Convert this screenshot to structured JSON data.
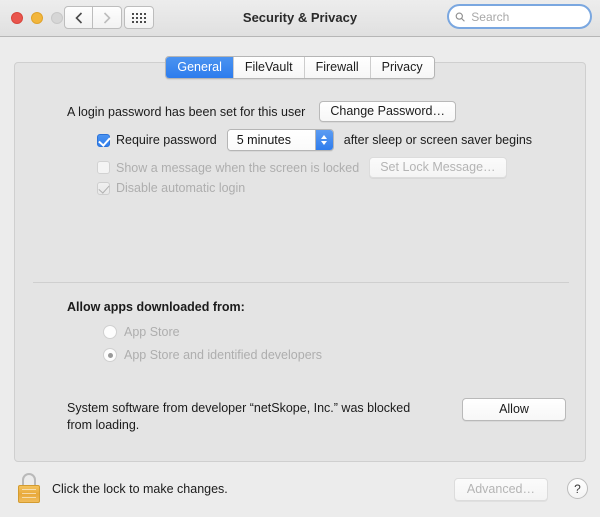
{
  "window": {
    "title": "Security & Privacy",
    "traffic_lights": [
      "close",
      "minimize",
      "zoom"
    ],
    "nav": {
      "back": "back-arrow",
      "forward": "forward-arrow",
      "grid": "show-all-grid"
    }
  },
  "search": {
    "placeholder": "Search",
    "value": "",
    "icon": "search-icon"
  },
  "tabs": [
    {
      "label": "General",
      "active": true
    },
    {
      "label": "FileVault",
      "active": false
    },
    {
      "label": "Firewall",
      "active": false
    },
    {
      "label": "Privacy",
      "active": false
    }
  ],
  "general": {
    "login_password_text": "A login password has been set for this user",
    "change_password_button": "Change Password…",
    "require_password": {
      "label": "Require password",
      "checked": true,
      "delay_value": "5 minutes",
      "suffix": "after sleep or screen saver begins"
    },
    "show_message": {
      "label": "Show a message when the screen is locked",
      "checked": false,
      "enabled": false,
      "button": "Set Lock Message…"
    },
    "disable_auto_login": {
      "label": "Disable automatic login",
      "checked": true,
      "enabled": false
    }
  },
  "allow_apps": {
    "title": "Allow apps downloaded from:",
    "options": [
      {
        "label": "App Store",
        "selected": false
      },
      {
        "label": "App Store and identified developers",
        "selected": true
      }
    ],
    "blocked_notice": "System software from developer “netSkope, Inc.” was blocked from loading.",
    "allow_button": "Allow"
  },
  "footer": {
    "lock_icon": "lock-closed-icon",
    "lock_text": "Click the lock to make changes.",
    "advanced_button": "Advanced…",
    "help_button": "?"
  },
  "colors": {
    "accent_blue": "#2f7ded",
    "window_bg": "#ececec",
    "panel_bg": "#e4e4e4",
    "lock_gold": "#e8a93b"
  }
}
